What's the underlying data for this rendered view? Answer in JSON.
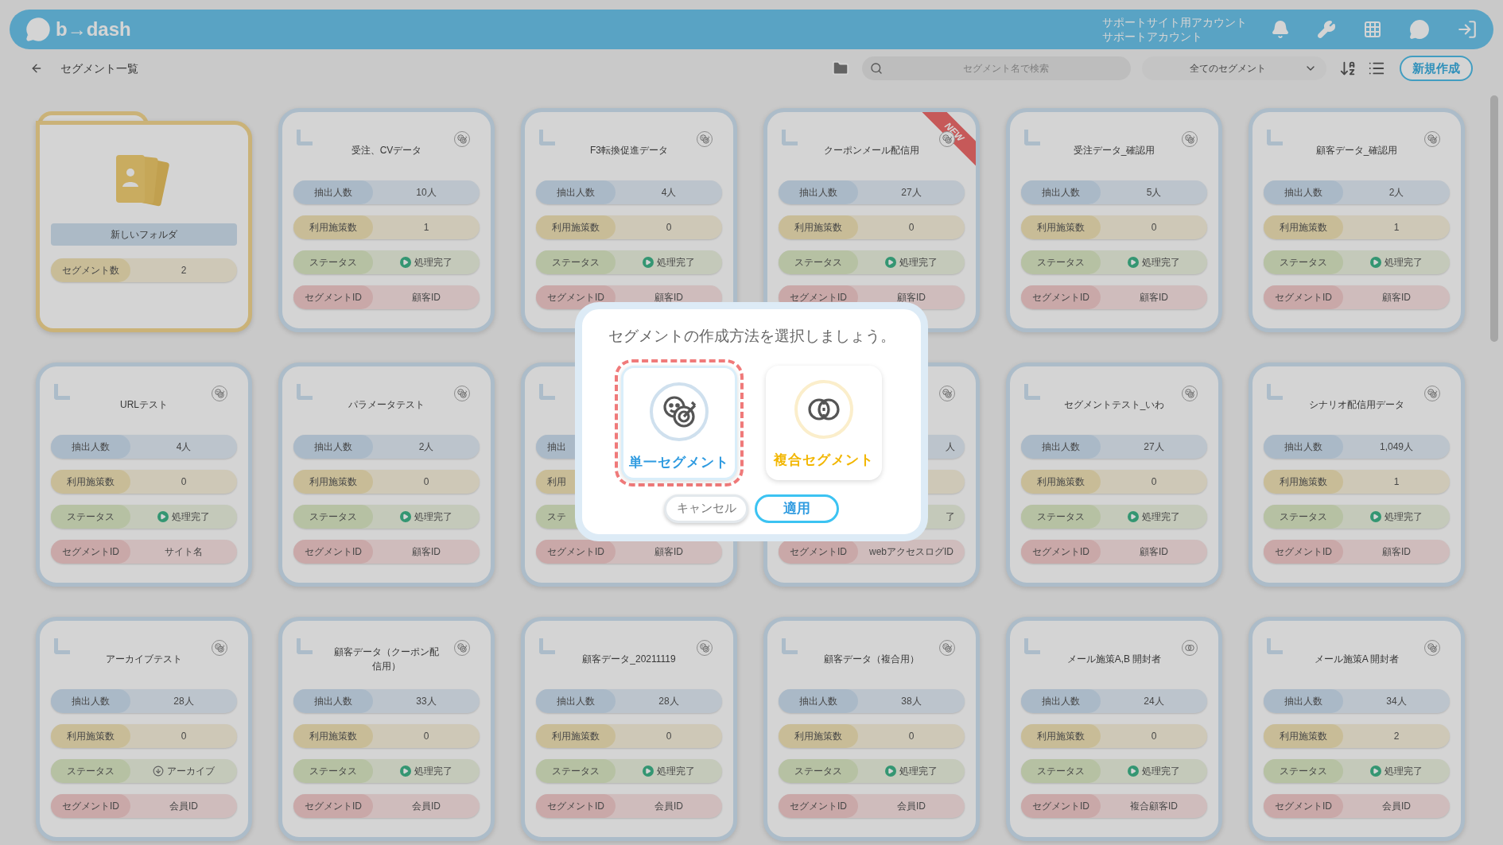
{
  "header": {
    "logo": "b→dash",
    "account_lines": [
      "サポートサイト用アカウント",
      "サポートアカウント"
    ]
  },
  "toolbar": {
    "title": "セグメント一覧",
    "search": {
      "placeholder": "セグメント名で検索"
    },
    "filter": {
      "value": "全てのセグメント"
    },
    "new_button": "新規作成"
  },
  "folder": {
    "name": "新しいフォルダ",
    "label": "セグメント数",
    "value": "2"
  },
  "cards": [
    {
      "title": "受注、CVデータ",
      "kind": "single",
      "fields": [
        {
          "kind": "count",
          "label": "抽出人数",
          "value": "10人"
        },
        {
          "kind": "usage",
          "label": "利用施策数",
          "value": "1"
        },
        {
          "kind": "status",
          "label": "ステータス",
          "value": "処理完了",
          "archived": false
        },
        {
          "kind": "id",
          "label": "セグメントID",
          "value": "顧客ID"
        }
      ]
    },
    {
      "title": "F3転換促進データ",
      "kind": "single",
      "fields": [
        {
          "kind": "count",
          "label": "抽出人数",
          "value": "4人"
        },
        {
          "kind": "usage",
          "label": "利用施策数",
          "value": "0"
        },
        {
          "kind": "status",
          "label": "ステータス",
          "value": "処理完了",
          "archived": false
        },
        {
          "kind": "id",
          "label": "セグメントID",
          "value": "顧客ID"
        }
      ]
    },
    {
      "title": "クーポンメール配信用",
      "kind": "single",
      "badge": "NEW",
      "fields": [
        {
          "kind": "count",
          "label": "抽出人数",
          "value": "27人"
        },
        {
          "kind": "usage",
          "label": "利用施策数",
          "value": "0"
        },
        {
          "kind": "status",
          "label": "ステータス",
          "value": "処理完了",
          "archived": false
        },
        {
          "kind": "id",
          "label": "セグメントID",
          "value": "顧客ID"
        }
      ]
    },
    {
      "title": "受注データ_確認用",
      "kind": "single",
      "fields": [
        {
          "kind": "count",
          "label": "抽出人数",
          "value": "5人"
        },
        {
          "kind": "usage",
          "label": "利用施策数",
          "value": "0"
        },
        {
          "kind": "status",
          "label": "ステータス",
          "value": "処理完了",
          "archived": false
        },
        {
          "kind": "id",
          "label": "セグメントID",
          "value": "顧客ID"
        }
      ]
    },
    {
      "title": "顧客データ_確認用",
      "kind": "single",
      "fields": [
        {
          "kind": "count",
          "label": "抽出人数",
          "value": "2人"
        },
        {
          "kind": "usage",
          "label": "利用施策数",
          "value": "1"
        },
        {
          "kind": "status",
          "label": "ステータス",
          "value": "処理完了",
          "archived": false
        },
        {
          "kind": "id",
          "label": "セグメントID",
          "value": "顧客ID"
        }
      ]
    },
    {
      "title": "URLテスト",
      "kind": "single",
      "fields": [
        {
          "kind": "count",
          "label": "抽出人数",
          "value": "4人"
        },
        {
          "kind": "usage",
          "label": "利用施策数",
          "value": "0"
        },
        {
          "kind": "status",
          "label": "ステータス",
          "value": "処理完了",
          "archived": false
        },
        {
          "kind": "id",
          "label": "セグメントID",
          "value": "サイト名"
        }
      ]
    },
    {
      "title": "パラメータテスト",
      "kind": "single",
      "fields": [
        {
          "kind": "count",
          "label": "抽出人数",
          "value": "2人"
        },
        {
          "kind": "usage",
          "label": "利用施策数",
          "value": "0"
        },
        {
          "kind": "status",
          "label": "ステータス",
          "value": "処理完了",
          "archived": false
        },
        {
          "kind": "id",
          "label": "セグメントID",
          "value": "顧客ID"
        }
      ]
    },
    {
      "fields": [
        {
          "kind": "count",
          "label": "抽出"
        },
        {
          "kind": "usage",
          "label": "利用"
        },
        {
          "kind": "status",
          "label": "ステ"
        },
        {
          "kind": "id",
          "label": "セグメントID",
          "value": "顧客ID"
        }
      ]
    },
    {
      "kind": "single",
      "fields": [
        {
          "kind": "count",
          "value": "人"
        },
        {
          "kind": "usage"
        },
        {
          "kind": "status",
          "value": "了"
        },
        {
          "kind": "id",
          "label": "セグメントID",
          "value": "webアクセスログID"
        }
      ]
    },
    {
      "title": "セグメントテスト_いわ",
      "kind": "single",
      "fields": [
        {
          "kind": "count",
          "label": "抽出人数",
          "value": "27人"
        },
        {
          "kind": "usage",
          "label": "利用施策数",
          "value": "0"
        },
        {
          "kind": "status",
          "label": "ステータス",
          "value": "処理完了",
          "archived": false
        },
        {
          "kind": "id",
          "label": "セグメントID",
          "value": "顧客ID"
        }
      ]
    },
    {
      "title": "シナリオ配信用データ",
      "kind": "single",
      "fields": [
        {
          "kind": "count",
          "label": "抽出人数",
          "value": "1,049人"
        },
        {
          "kind": "usage",
          "label": "利用施策数",
          "value": "1"
        },
        {
          "kind": "status",
          "label": "ステータス",
          "value": "処理完了",
          "archived": false
        },
        {
          "kind": "id",
          "label": "セグメントID",
          "value": "顧客ID"
        }
      ]
    },
    {
      "title": "アーカイブテスト",
      "kind": "single",
      "fields": [
        {
          "kind": "count",
          "label": "抽出人数",
          "value": "28人"
        },
        {
          "kind": "usage",
          "label": "利用施策数",
          "value": "0"
        },
        {
          "kind": "status",
          "label": "ステータス",
          "value": "アーカイブ",
          "archived": true
        },
        {
          "kind": "id",
          "label": "セグメントID",
          "value": "会員ID"
        }
      ]
    },
    {
      "title": "顧客データ（クーポン配信用）",
      "kind": "single",
      "fields": [
        {
          "kind": "count",
          "label": "抽出人数",
          "value": "33人"
        },
        {
          "kind": "usage",
          "label": "利用施策数",
          "value": "0"
        },
        {
          "kind": "status",
          "label": "ステータス",
          "value": "処理完了",
          "archived": false
        },
        {
          "kind": "id",
          "label": "セグメントID",
          "value": "会員ID"
        }
      ]
    },
    {
      "title": "顧客データ_20211119",
      "kind": "single",
      "fields": [
        {
          "kind": "count",
          "label": "抽出人数",
          "value": "28人"
        },
        {
          "kind": "usage",
          "label": "利用施策数",
          "value": "0"
        },
        {
          "kind": "status",
          "label": "ステータス",
          "value": "処理完了",
          "archived": false
        },
        {
          "kind": "id",
          "label": "セグメントID",
          "value": "会員ID"
        }
      ]
    },
    {
      "title": "顧客データ（複合用）",
      "kind": "single",
      "fields": [
        {
          "kind": "count",
          "label": "抽出人数",
          "value": "38人"
        },
        {
          "kind": "usage",
          "label": "利用施策数",
          "value": "0"
        },
        {
          "kind": "status",
          "label": "ステータス",
          "value": "処理完了",
          "archived": false
        },
        {
          "kind": "id",
          "label": "セグメントID",
          "value": "会員ID"
        }
      ]
    },
    {
      "title": "メール施策A,B 開封者",
      "kind": "composite",
      "fields": [
        {
          "kind": "count",
          "label": "抽出人数",
          "value": "24人"
        },
        {
          "kind": "usage",
          "label": "利用施策数",
          "value": "0"
        },
        {
          "kind": "status",
          "label": "ステータス",
          "value": "処理完了",
          "archived": false
        },
        {
          "kind": "id",
          "label": "セグメントID",
          "value": "複合顧客ID"
        }
      ]
    },
    {
      "title": "メール施策A 開封者",
      "kind": "single",
      "fields": [
        {
          "kind": "count",
          "label": "抽出人数",
          "value": "34人"
        },
        {
          "kind": "usage",
          "label": "利用施策数",
          "value": "2"
        },
        {
          "kind": "status",
          "label": "ステータス",
          "value": "処理完了",
          "archived": false
        },
        {
          "kind": "id",
          "label": "セグメントID",
          "value": "会員ID"
        }
      ]
    }
  ],
  "dialog": {
    "title": "セグメントの作成方法を選択しましょう。",
    "options": [
      {
        "kind": "single",
        "label": "単一セグメント",
        "selected": true
      },
      {
        "kind": "composite",
        "label": "複合セグメント",
        "selected": false
      }
    ],
    "buttons": [
      {
        "kind": "cancel",
        "label": "キャンセル"
      },
      {
        "kind": "apply",
        "label": "適用"
      }
    ]
  }
}
